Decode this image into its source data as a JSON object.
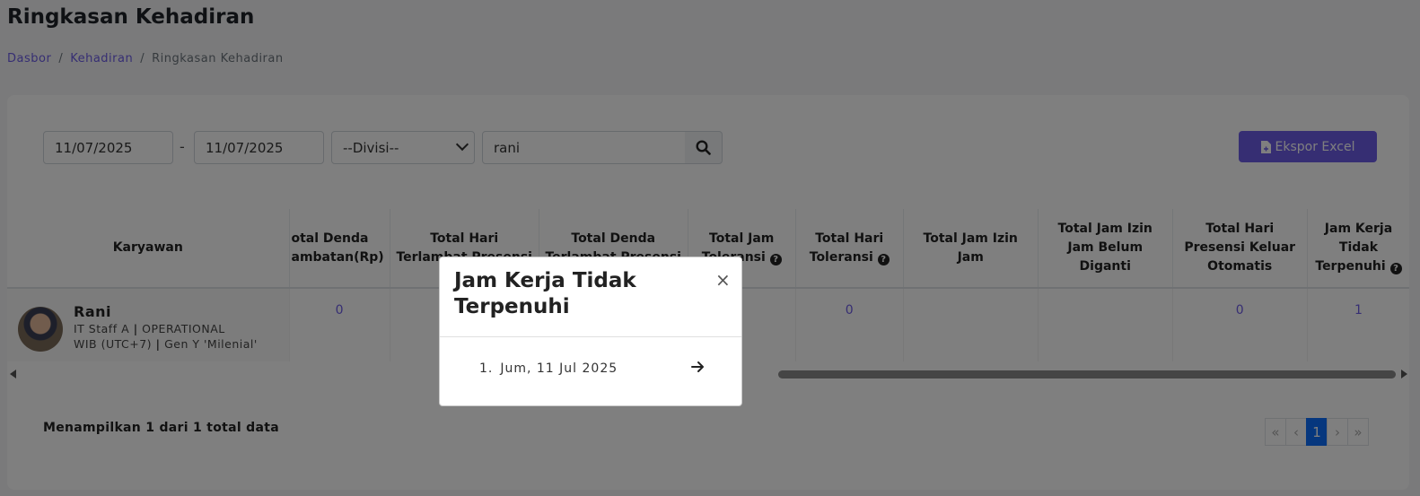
{
  "page": {
    "title": "Ringkasan Kehadiran",
    "breadcrumb": [
      "Dasbor",
      "Kehadiran",
      "Ringkasan Kehadiran"
    ]
  },
  "filters": {
    "date_from": "11/07/2025",
    "separator": "-",
    "date_to": "11/07/2025",
    "division": "--Divisi--",
    "search_value": "rani",
    "export_label": "Ekspor Excel"
  },
  "table": {
    "headers": {
      "employee": "Karyawan",
      "c1": "otal Denda",
      "c1b": "ambatan(Rp)",
      "c2": "Total Hari",
      "c2b": "Terlambat Presensi",
      "c3": "Total Denda",
      "c3b": "Terlambat Presensi",
      "c4": "Total Jam",
      "c4b": "Toleransi",
      "c5": "Total Hari",
      "c5b": "Toleransi",
      "c6": "Total Jam Izin",
      "c6b": "Jam",
      "c7": "Total Jam Izin",
      "c7b": "Jam Belum",
      "c7c": "Diganti",
      "c8": "Total Hari",
      "c8b": "Presensi Keluar",
      "c8c": "Otomatis",
      "c9": "Jam Kerja",
      "c9b": "Tidak",
      "c9c": "Terpenuhi"
    },
    "row": {
      "name": "Rani",
      "position": "IT Staff A",
      "division": "OPERATIONAL",
      "timezone": "WIB (UTC+7)",
      "generation": "Gen Y 'Milenial'",
      "c1": "0",
      "c5": "0",
      "c8": "0",
      "c9": "1"
    }
  },
  "footer": {
    "showing": "Menampilkan 1 dari 1 total data",
    "pagination": [
      "«",
      "‹",
      "1",
      "›",
      "»"
    ]
  },
  "modal": {
    "title": "Jam Kerja Tidak Terpenuhi",
    "close": "×",
    "items": [
      {
        "index": "1.",
        "label": "Jum, 11 Jul 2025"
      }
    ]
  }
}
